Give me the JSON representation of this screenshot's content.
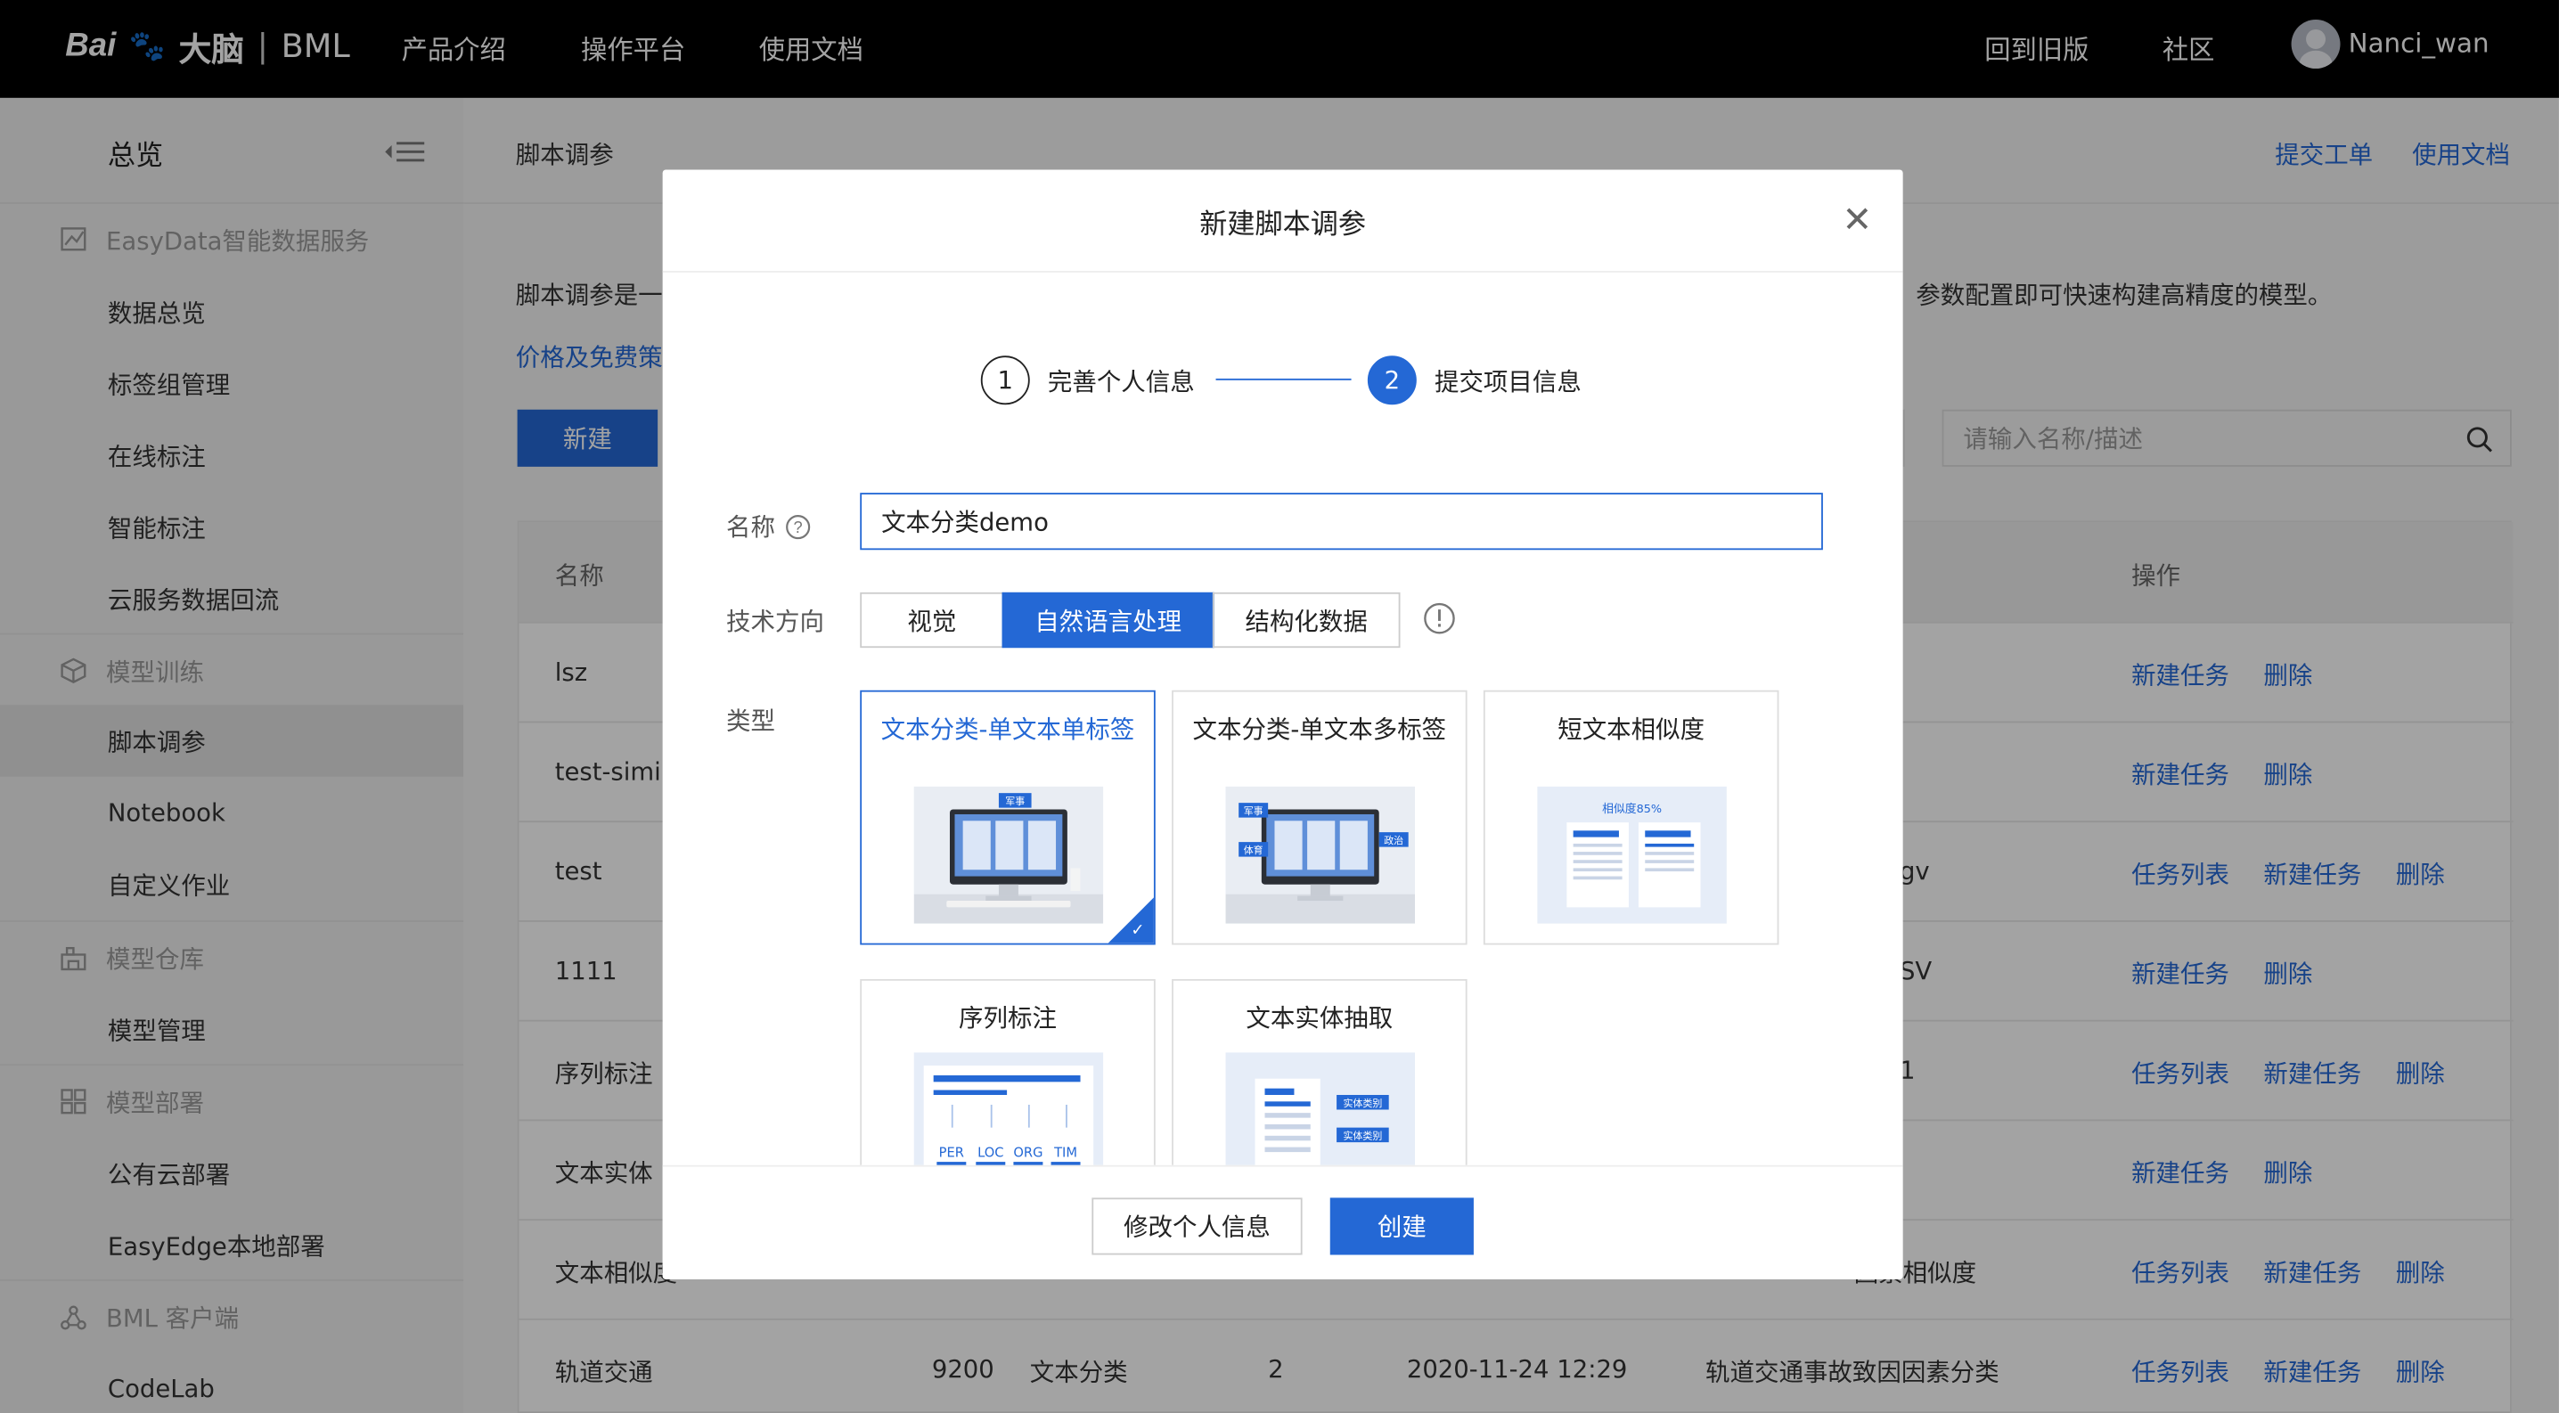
{
  "topbar": {
    "brand_bai": "Bai",
    "brand_paw": "du",
    "brand_dai": "大脑",
    "brand_sep": "|",
    "brand_bml": "BML",
    "nav": [
      "产品介绍",
      "操作平台",
      "使用文档"
    ],
    "right_nav": [
      "回到旧版",
      "社区"
    ],
    "username": "Nanci_wan"
  },
  "sidebar": {
    "overview": "总览",
    "items": [
      {
        "type": "cat",
        "label": "EasyData智能数据服务",
        "icon": "chart-icon"
      },
      {
        "type": "sub",
        "label": "数据总览"
      },
      {
        "type": "sub",
        "label": "标签组管理"
      },
      {
        "type": "sub",
        "label": "在线标注"
      },
      {
        "type": "sub",
        "label": "智能标注"
      },
      {
        "type": "sub",
        "label": "云服务数据回流"
      },
      {
        "type": "cat",
        "label": "模型训练",
        "icon": "cube-icon"
      },
      {
        "type": "sub",
        "label": "脚本调参",
        "active": true
      },
      {
        "type": "sub",
        "label": "Notebook"
      },
      {
        "type": "sub",
        "label": "自定义作业"
      },
      {
        "type": "cat",
        "label": "模型仓库",
        "icon": "warehouse-icon"
      },
      {
        "type": "sub",
        "label": "模型管理"
      },
      {
        "type": "cat",
        "label": "模型部署",
        "icon": "deploy-icon"
      },
      {
        "type": "sub",
        "label": "公有云部署"
      },
      {
        "type": "sub",
        "label": "EasyEdge本地部署"
      },
      {
        "type": "cat",
        "label": "BML 客户端",
        "icon": "client-icon"
      },
      {
        "type": "sub",
        "label": "CodeLab"
      }
    ]
  },
  "content": {
    "breadcrumb": "脚本调参",
    "submit_ticket": "提交工单",
    "docs": "使用文档",
    "desc_left": "脚本调参是一",
    "desc_right": "参数配置即可快速构建高精度的模型。",
    "price_link": "价格及免费策",
    "new_button": "新建",
    "search_placeholder": "请输入名称/描述",
    "table": {
      "header_name": "名称",
      "header_ops": "操作",
      "rows": [
        {
          "name": "lsz",
          "extra": "",
          "ops": [
            "新建任务",
            "删除"
          ]
        },
        {
          "name": "test-simil",
          "extra": "",
          "ops": [
            "新建任务",
            "删除"
          ]
        },
        {
          "name": "test",
          "extra": "gv",
          "ops": [
            "任务列表",
            "新建任务",
            "删除"
          ]
        },
        {
          "name": "1111",
          "extra": "SV",
          "ops": [
            "新建任务",
            "删除"
          ]
        },
        {
          "name": "序列标注",
          "extra": "1",
          "ops": [
            "任务列表",
            "新建任务",
            "删除"
          ]
        },
        {
          "name": "文本实体",
          "extra": "",
          "ops": [
            "新建任务",
            "删除"
          ]
        },
        {
          "name": "文本相似度",
          "extra": "因素相似度",
          "ops": [
            "任务列表",
            "新建任务",
            "删除"
          ]
        },
        {
          "name": "轨道交通",
          "id": "9200",
          "type": "文本分类",
          "ver": "2",
          "time": "2020-11-24 12:29",
          "desc": "轨道交通事故致因因素分类",
          "ops": [
            "任务列表",
            "新建任务",
            "删除"
          ]
        }
      ]
    }
  },
  "modal": {
    "title": "新建脚本调参",
    "close": "✕",
    "step1_num": "1",
    "step1_label": "完善个人信息",
    "step2_num": "2",
    "step2_label": "提交项目信息",
    "name_label": "名称",
    "name_value": "文本分类demo",
    "direction_label": "技术方向",
    "directions": [
      "视觉",
      "自然语言处理",
      "结构化数据"
    ],
    "direction_selected": "自然语言处理",
    "type_label": "类型",
    "cards": [
      {
        "title": "文本分类-单文本单标签",
        "tag": "军事",
        "selected": true
      },
      {
        "title": "文本分类-单文本多标签",
        "tags": [
          "军事",
          "体育",
          "政治"
        ]
      },
      {
        "title": "短文本相似度",
        "tag": "相似度85%"
      },
      {
        "title": "序列标注",
        "tags": [
          "PER",
          "LOC",
          "ORG",
          "TIM"
        ]
      },
      {
        "title": "文本实体抽取",
        "tags": [
          "实体类别",
          "实体类别"
        ]
      }
    ],
    "btn_edit": "修改个人信息",
    "btn_create": "创建"
  },
  "colors": {
    "accent": "#2468d5",
    "topbar": "#000000"
  }
}
